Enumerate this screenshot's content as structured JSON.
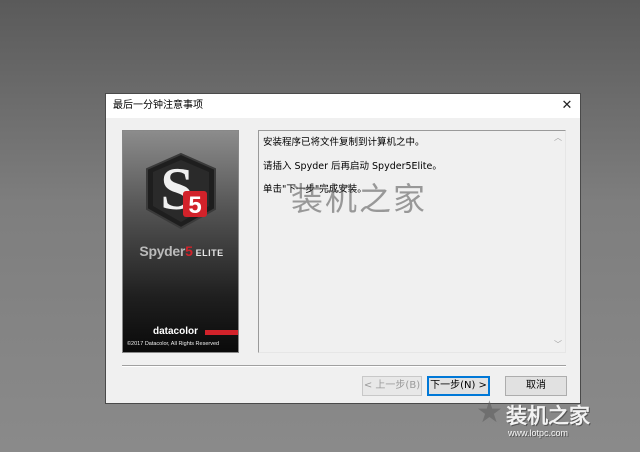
{
  "dialog": {
    "title": "最后一分钟注意事项",
    "close_glyph": "✕",
    "messages": [
      "安装程序已将文件复制到计算机之中。",
      "请插入 Spyder 后再启动 Spyder5Elite。",
      "单击\"下一步\"完成安装。"
    ],
    "buttons": {
      "back": "< 上一步(B)",
      "next": "下一步(N) >",
      "cancel": "取消"
    }
  },
  "side_image": {
    "logo_letter": "S",
    "logo_number": "5",
    "product_name": "Spyder",
    "product_number": "5",
    "edition": "ELITE",
    "brand": "datacolor",
    "copyright": "©2017 Datacolor, All Rights Reserved"
  },
  "scrollbar": {
    "up_glyph": "︿",
    "down_glyph": "﹀"
  },
  "watermark": {
    "center_text": "装机之家",
    "corner_text": "装机之家",
    "corner_url": "www.lotpc.com",
    "star_glyph": "★"
  },
  "colors": {
    "brand_red": "#d2222a",
    "focus_blue": "#0078d7"
  }
}
